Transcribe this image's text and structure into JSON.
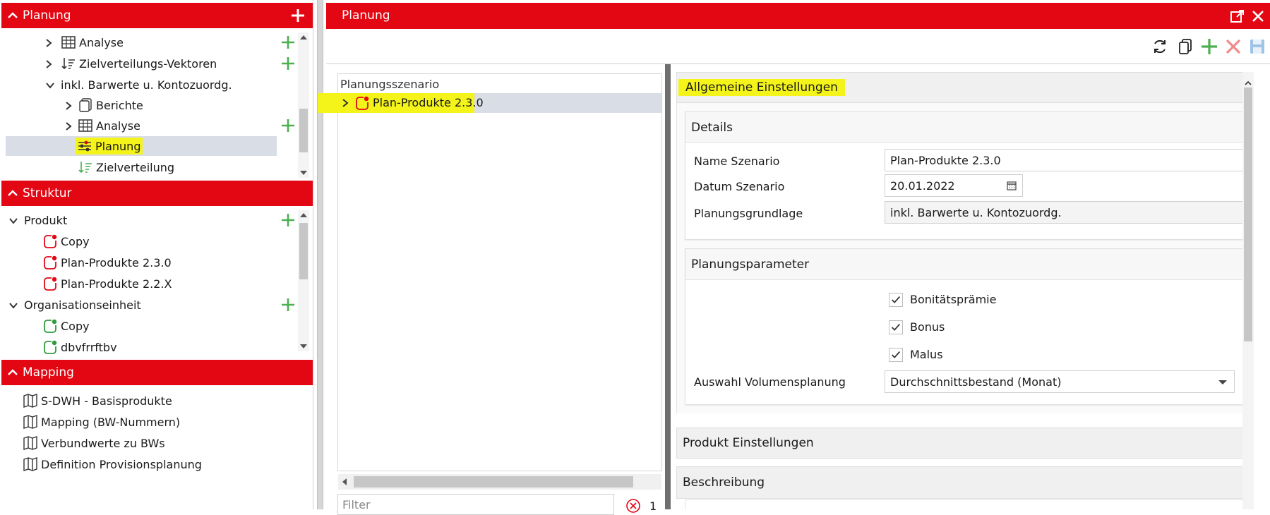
{
  "sections": {
    "planung": "Planung",
    "struktur": "Struktur",
    "mapping": "Mapping"
  },
  "planung_tree": [
    {
      "label": "Analyse",
      "icon": "table-icon"
    },
    {
      "label": "Zielverteilungs-Vektoren",
      "icon": "sort-distribution-icon"
    },
    {
      "label": "inkl. Barwerte u. Kontozuordg.",
      "icon": ""
    },
    {
      "label": "Berichte",
      "icon": "report-icon"
    },
    {
      "label": "Analyse",
      "icon": "table-icon"
    },
    {
      "label": "Planung",
      "icon": "sliders-icon"
    },
    {
      "label": "Zielverteilung",
      "icon": "sort-distribution-icon"
    }
  ],
  "struktur_tree": [
    {
      "label": "Produkt"
    },
    {
      "label": "Copy",
      "status": "red"
    },
    {
      "label": "Plan-Produkte 2.3.0",
      "status": "red"
    },
    {
      "label": "Plan-Produkte 2.2.X",
      "status": "red"
    },
    {
      "label": "Organisationseinheit"
    },
    {
      "label": "Copy",
      "status": "green"
    },
    {
      "label": "dbvfrrftbv",
      "status": "green"
    }
  ],
  "mapping_items": [
    "S-DWH - Basisprodukte",
    "Mapping (BW-Nummern)",
    "Verbundwerte zu BWs",
    "Definition Provisionsplanung"
  ],
  "window": {
    "title": "Planung"
  },
  "scenario_list": {
    "header": "Planungsszenario",
    "item": "Plan-Produkte 2.3.0",
    "filter_placeholder": "Filter",
    "count": "1"
  },
  "settings": {
    "general_title": "Allgemeine Einstellungen",
    "details_title": "Details",
    "name_label": "Name Szenario",
    "name_value": "Plan-Produkte 2.3.0",
    "date_label": "Datum Szenario",
    "date_value": "20.01.2022",
    "basis_label": "Planungsgrundlage",
    "basis_value": "inkl. Barwerte u. Kontozuordg.",
    "params_title": "Planungsparameter",
    "checkbox_1": "Bonitätsprämie",
    "checkbox_2": "Bonus",
    "checkbox_3": "Malus",
    "volume_label": "Auswahl Volumensplanung",
    "volume_value": "Durchschnittsbestand (Monat)",
    "product_title": "Produkt Einstellungen",
    "description_title": "Beschreibung"
  },
  "colors": {
    "brand_red": "#e30613",
    "green": "#4caf50",
    "highlight": "#f4f41a",
    "selected_row": "#d9dee6"
  }
}
